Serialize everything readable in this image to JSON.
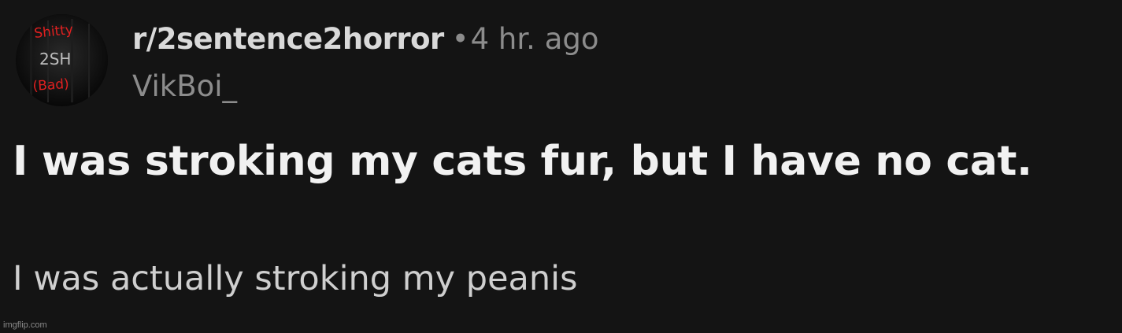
{
  "post": {
    "subreddit": "r/2sentence2horror",
    "separator": "•",
    "time_ago": "4 hr. ago",
    "author": "VikBoi_",
    "title": "I was stroking my cats fur, but I have no cat.",
    "body": "I was actually stroking my peanis"
  },
  "avatar": {
    "icon": "subreddit-avatar-icon",
    "logo_text": [
      "Shitty",
      "2SH",
      "(Bad)"
    ]
  },
  "watermark": "imgflip.com",
  "colors": {
    "background": "#141414",
    "title": "#f1f1f1",
    "subreddit": "#d9d9d9",
    "meta": "#8c8c8c",
    "body": "#cfcfcf",
    "avatar_red": "#e02020"
  }
}
